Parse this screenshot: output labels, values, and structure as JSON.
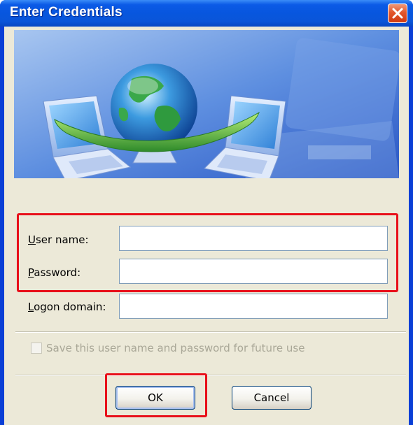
{
  "window": {
    "title": "Enter Credentials"
  },
  "form": {
    "username_label_prefix": "U",
    "username_label_rest": "ser name:",
    "username_value": "",
    "password_label_prefix": "P",
    "password_label_rest": "assword:",
    "password_value": "",
    "domain_label_prefix": "L",
    "domain_label_rest": "ogon domain:",
    "domain_value": "",
    "save_label_prefix": "S",
    "save_label_rest": "ave this user name and password for future use",
    "save_checked": false,
    "save_enabled": false
  },
  "buttons": {
    "ok_label": "OK",
    "cancel_label": "Cancel"
  },
  "icons": {
    "close": "close-icon",
    "banner": "network-globe-laptops-illustration"
  },
  "colors": {
    "titlebar": "#0756de",
    "dialog_bg": "#ece9d8",
    "close_button": "#e2572c",
    "highlight": "#e8101a"
  }
}
